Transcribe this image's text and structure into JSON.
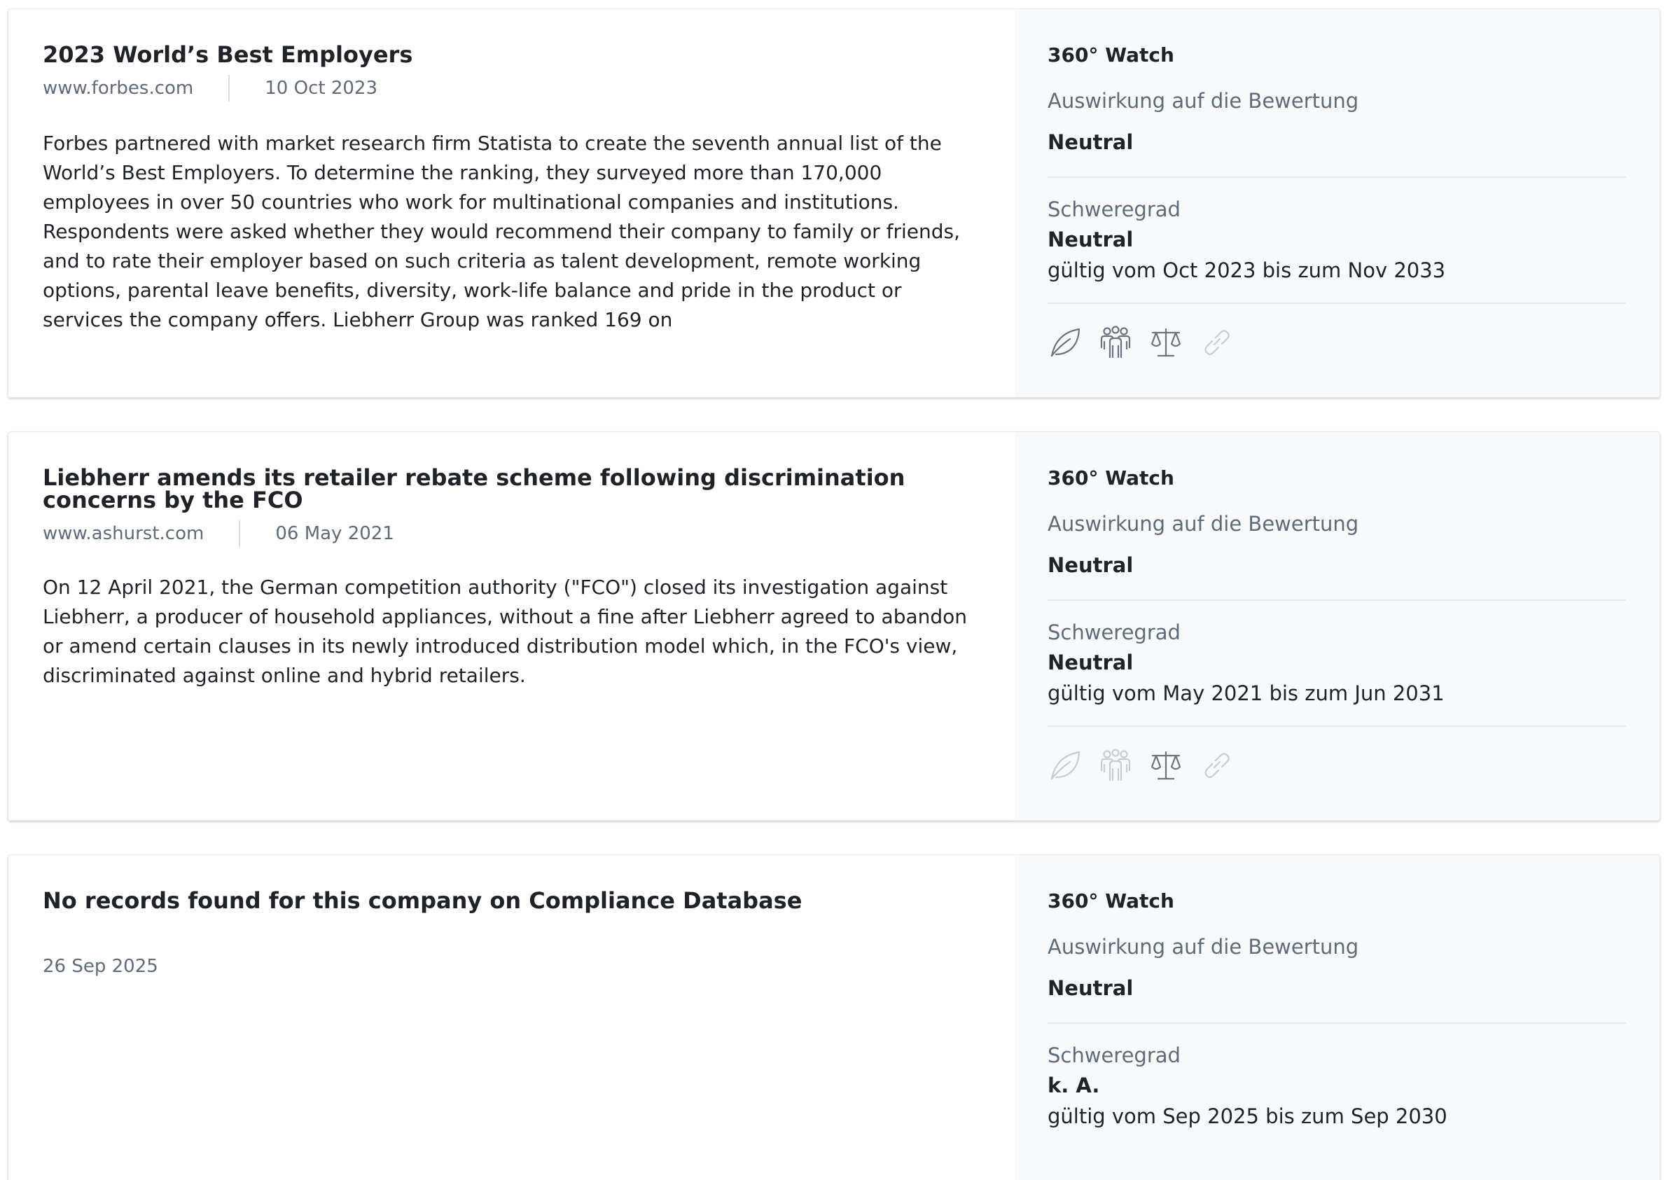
{
  "cards": [
    {
      "title": "2023 World’s Best Employers",
      "source": "www.forbes.com",
      "date": "10 Oct 2023",
      "body": "Forbes partnered with market research firm Statista to create the seventh annual list of the World’s Best Employers. To determine the ranking, they surveyed more than 170,000 employees in over 50 countries who work for multinational companies and institutions. Respondents were asked whether they would recommend their company to family or friends, and to rate their employer based on such criteria as talent development, remote working options, parental leave benefits, diversity, work-life balance and pride in the product or services the company offers. Liebherr Group was ranked 169 on",
      "side": {
        "heading": "360° Watch",
        "impact_label": "Auswirkung auf die Bewertung",
        "impact_value": "Neutral",
        "severity_label": "Schweregrad",
        "severity_value": "Neutral",
        "validity": "gültig vom Oct 2023 bis zum Nov 2033"
      },
      "icons": [
        {
          "name": "leaf-icon",
          "active": true
        },
        {
          "name": "people-icon",
          "active": true
        },
        {
          "name": "scales-icon",
          "active": true
        },
        {
          "name": "link-icon",
          "active": false
        }
      ]
    },
    {
      "title": "Liebherr amends its retailer rebate scheme following discrimination concerns by the FCO",
      "source": "www.ashurst.com",
      "date": "06 May 2021",
      "body": "On 12 April 2021, the German competition authority (\"FCO\") closed its investigation against Liebherr, a producer of household appliances, without a fine after Liebherr agreed to abandon or amend certain clauses in its newly introduced distribution model which, in the FCO's view, discriminated against online and hybrid retailers.",
      "side": {
        "heading": "360° Watch",
        "impact_label": "Auswirkung auf die Bewertung",
        "impact_value": "Neutral",
        "severity_label": "Schweregrad",
        "severity_value": "Neutral",
        "validity": "gültig vom May 2021 bis zum Jun 2031"
      },
      "icons": [
        {
          "name": "leaf-icon",
          "active": false
        },
        {
          "name": "people-icon",
          "active": false
        },
        {
          "name": "scales-icon",
          "active": true
        },
        {
          "name": "link-icon",
          "active": false
        }
      ]
    },
    {
      "title": "No records found for this company on Compliance Database",
      "date": "26 Sep 2025",
      "side": {
        "heading": "360° Watch",
        "impact_label": "Auswirkung auf die Bewertung",
        "impact_value": "Neutral",
        "severity_label": "Schweregrad",
        "severity_value": "k. A.",
        "validity": "gültig vom Sep 2025 bis zum Sep 2030"
      }
    }
  ],
  "colors": {
    "icon_active": "#6b7280",
    "icon_inactive": "#c8ccd1",
    "muted_text": "#5f6b7a",
    "side_bg": "#f8f9fa"
  }
}
